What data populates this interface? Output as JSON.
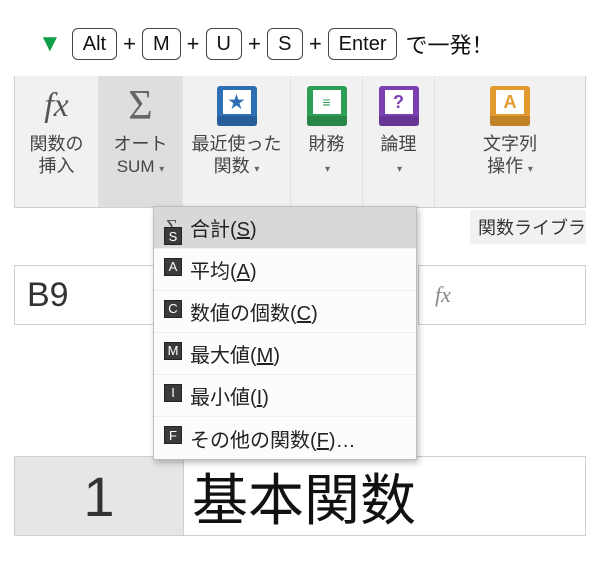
{
  "tip": {
    "keys": [
      "Alt",
      "M",
      "U",
      "S",
      "Enter"
    ],
    "tail": "で一発！"
  },
  "ribbon": {
    "insertFn": {
      "line1": "関数の",
      "line2": "挿入"
    },
    "autosum": {
      "line1": "オート",
      "line2": "SUM"
    },
    "recent": {
      "line1": "最近使った",
      "line2": "関数"
    },
    "financial": {
      "line1": "財務"
    },
    "logical": {
      "line1": "論理"
    },
    "text": {
      "line1": "文字列",
      "line2": "操作"
    },
    "library_label": "関数ライブラ"
  },
  "menu": {
    "items": [
      {
        "label": "合計",
        "accel": "S",
        "keytip": "S"
      },
      {
        "label": "平均",
        "accel": "A",
        "keytip": "A"
      },
      {
        "label": "数値の個数",
        "accel": "C",
        "keytip": "C"
      },
      {
        "label": "最大値",
        "accel": "M",
        "keytip": "M"
      },
      {
        "label": "最小値",
        "accel": "I",
        "keytip": "I"
      },
      {
        "label": "その他の関数",
        "accel": "F",
        "keytip": "F",
        "trail": "…"
      }
    ]
  },
  "namebox": "B9",
  "row": {
    "num": "1",
    "cell": "基本関数"
  }
}
